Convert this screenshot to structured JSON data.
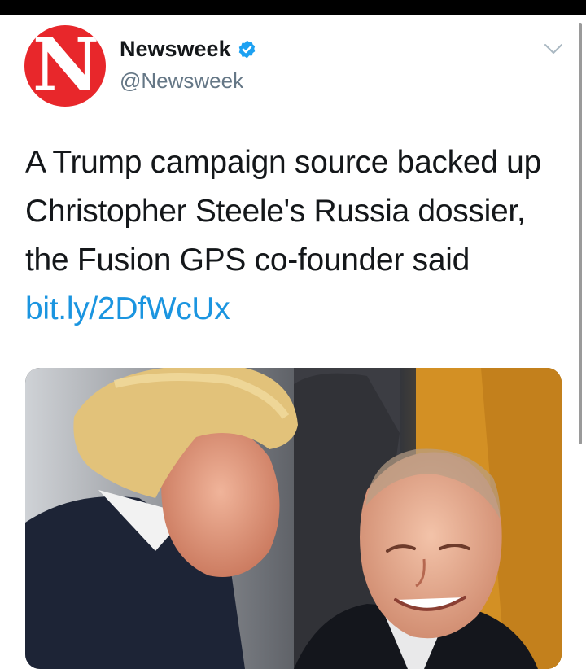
{
  "account": {
    "display_name": "Newsweek",
    "handle": "@Newsweek",
    "avatar_letter": "N",
    "avatar_color": "#e8272b",
    "verified": true,
    "verified_color": "#1da1f2"
  },
  "tweet": {
    "text": "A Trump campaign source backed up Christopher Steele's Russia dossier, the Fusion GPS co-founder said ",
    "link_text": "bit.ly/2DfWcUx",
    "link_color": "#1b95e0"
  },
  "icons": {
    "menu": "chevron-down-icon",
    "badge": "verified-badge-icon"
  },
  "media": {
    "type": "photo"
  }
}
